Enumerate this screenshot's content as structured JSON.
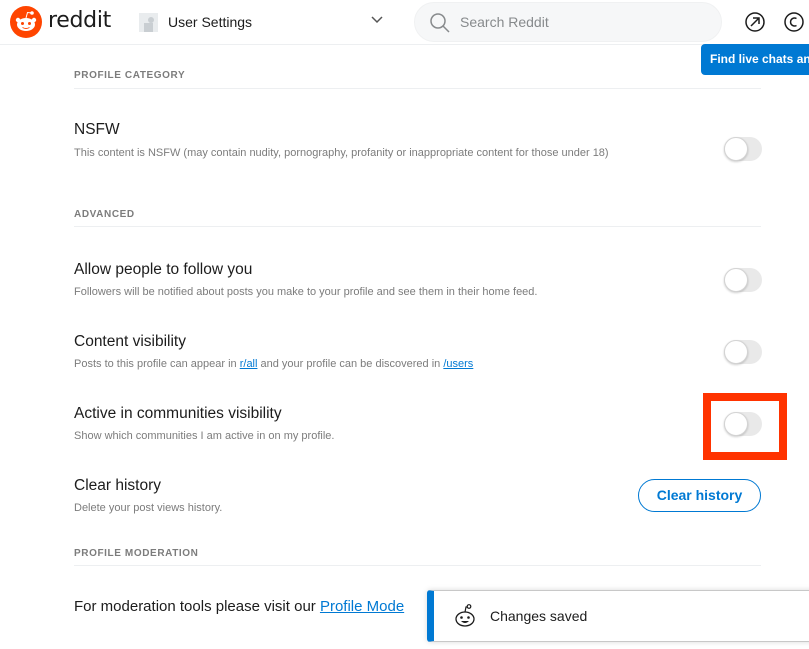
{
  "header": {
    "brand": "reddit",
    "page_title": "User Settings",
    "search_placeholder": "Search Reddit",
    "tooltip": "Find live chats and",
    "icons": [
      "reddit-logo-icon",
      "settings-avatar-icon",
      "chevron-down-icon",
      "search-icon",
      "popular-arrow-icon",
      "coins-icon"
    ]
  },
  "colors": {
    "brand": "#ff4500",
    "accent": "#0079d3",
    "highlight": "#ff3300"
  },
  "sections": {
    "profile_category": {
      "label": "PROFILE CATEGORY",
      "items": [
        {
          "title": "NSFW",
          "description": "This content is NSFW (may contain nudity, pornography, profanity or inappropriate content for those under 18)",
          "enabled": false
        }
      ]
    },
    "advanced": {
      "label": "ADVANCED",
      "items": [
        {
          "title": "Allow people to follow you",
          "description": "Followers will be notified about posts you make to your profile and see them in their home feed.",
          "enabled": false
        },
        {
          "title": "Content visibility",
          "description_prefix": "Posts to this profile can appear in ",
          "link1": "r/all",
          "description_middle": " and your profile can be discovered in ",
          "link2": "/users",
          "enabled": false
        },
        {
          "title": "Active in communities visibility",
          "description": "Show which communities I am active in on my profile.",
          "enabled": false,
          "highlighted": true
        },
        {
          "title": "Clear history",
          "description": "Delete your post views history.",
          "button_label": "Clear history"
        }
      ]
    },
    "profile_moderation": {
      "label": "PROFILE MODERATION",
      "text_prefix": "For moderation tools please visit our ",
      "link": "Profile Mode"
    }
  },
  "toast": {
    "message": "Changes saved"
  }
}
